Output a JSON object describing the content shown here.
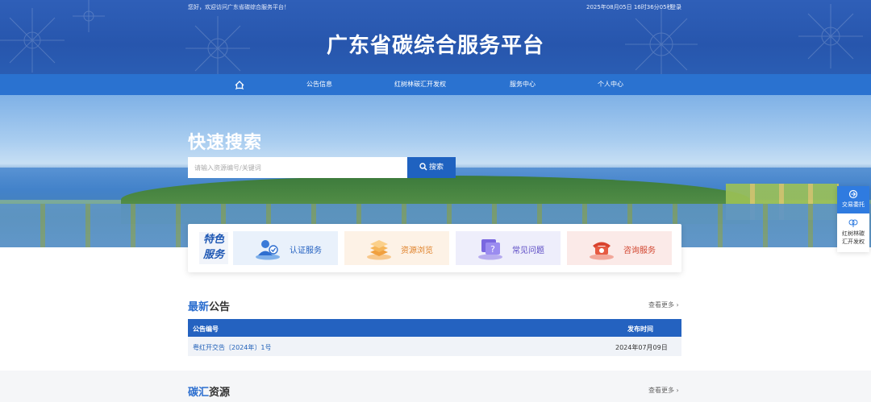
{
  "topbar": {
    "welcome": "您好，欢迎访问广东省碳综合服务平台！",
    "datetime": "2025年08月05日 16时36分05秒",
    "login": "登录"
  },
  "site_title": "广东省碳综合服务平台",
  "nav": {
    "home_icon": "home-icon",
    "items": [
      "公告信息",
      "红树林碳汇开发权",
      "服务中心",
      "个人中心"
    ]
  },
  "search": {
    "title": "快速搜索",
    "placeholder": "请输入资源编号/关键词",
    "button": "搜索"
  },
  "features": {
    "label_line1": "特色",
    "label_line2": "服务",
    "cards": [
      {
        "label": "认证服务",
        "icon": "certification-icon",
        "color": "#2260c0"
      },
      {
        "label": "资源浏览",
        "icon": "resource-browse-icon",
        "color": "#e0822a"
      },
      {
        "label": "常见问题",
        "icon": "faq-icon",
        "color": "#5a49c4"
      },
      {
        "label": "咨询服务",
        "icon": "phone-icon",
        "color": "#d2452f"
      }
    ]
  },
  "announcements": {
    "title_highlight": "最新",
    "title_rest": "公告",
    "more": "查看更多",
    "columns": [
      "公告编号",
      "发布时间"
    ],
    "rows": [
      {
        "number": "粤红开交告〔2024年〕1号",
        "date": "2024年07月09日"
      }
    ]
  },
  "carbon_sink": {
    "title_highlight": "碳汇",
    "title_rest": "资源",
    "more": "查看更多"
  },
  "float_panel": {
    "item1": "交易委托",
    "item2": "红树林碳汇开发权"
  },
  "colors": {
    "header_blue": "#2756ad",
    "nav_blue": "#2a72d0",
    "accent": "#2462c0"
  }
}
